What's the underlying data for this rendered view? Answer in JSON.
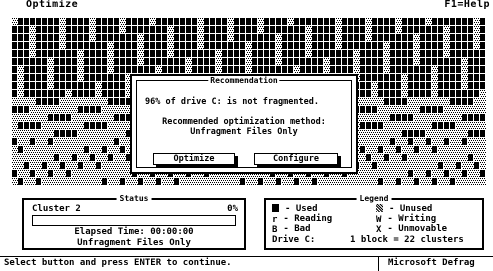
{
  "topbar": {
    "menu_label": "Optimize",
    "help_label": "F1=Help"
  },
  "dialog": {
    "title": "Recommendation",
    "message": "96% of drive C: is not fragmented.",
    "recommend_label": "Recommended optimization method:",
    "recommend_value": "Unfragment Files Only",
    "buttons": {
      "optimize": "Optimize",
      "configure": "Configure"
    }
  },
  "status": {
    "title": "Status",
    "cluster": "Cluster 2",
    "percent": "0%",
    "progress_percent": 0,
    "elapsed": "Elapsed Time: 00:00:00",
    "method": "Unfragment Files Only"
  },
  "legend": {
    "title": "Legend",
    "items": [
      {
        "symbol": "",
        "label": "- Used"
      },
      {
        "symbol": "r",
        "label": "- Reading"
      },
      {
        "symbol": "B",
        "label": "- Bad"
      },
      {
        "symbol": "",
        "label": "- Unused"
      },
      {
        "symbol": "W",
        "label": "- Writing"
      },
      {
        "symbol": "X",
        "label": "- Unmovable"
      }
    ],
    "drive_label": "Drive C:",
    "block_label": "1 block = 22 clusters"
  },
  "bottom": {
    "hint": "Select button and press ENTER to continue.",
    "app_name": "Microsoft Defrag"
  },
  "colors": {
    "background": "#ffffff",
    "foreground": "#000000"
  }
}
